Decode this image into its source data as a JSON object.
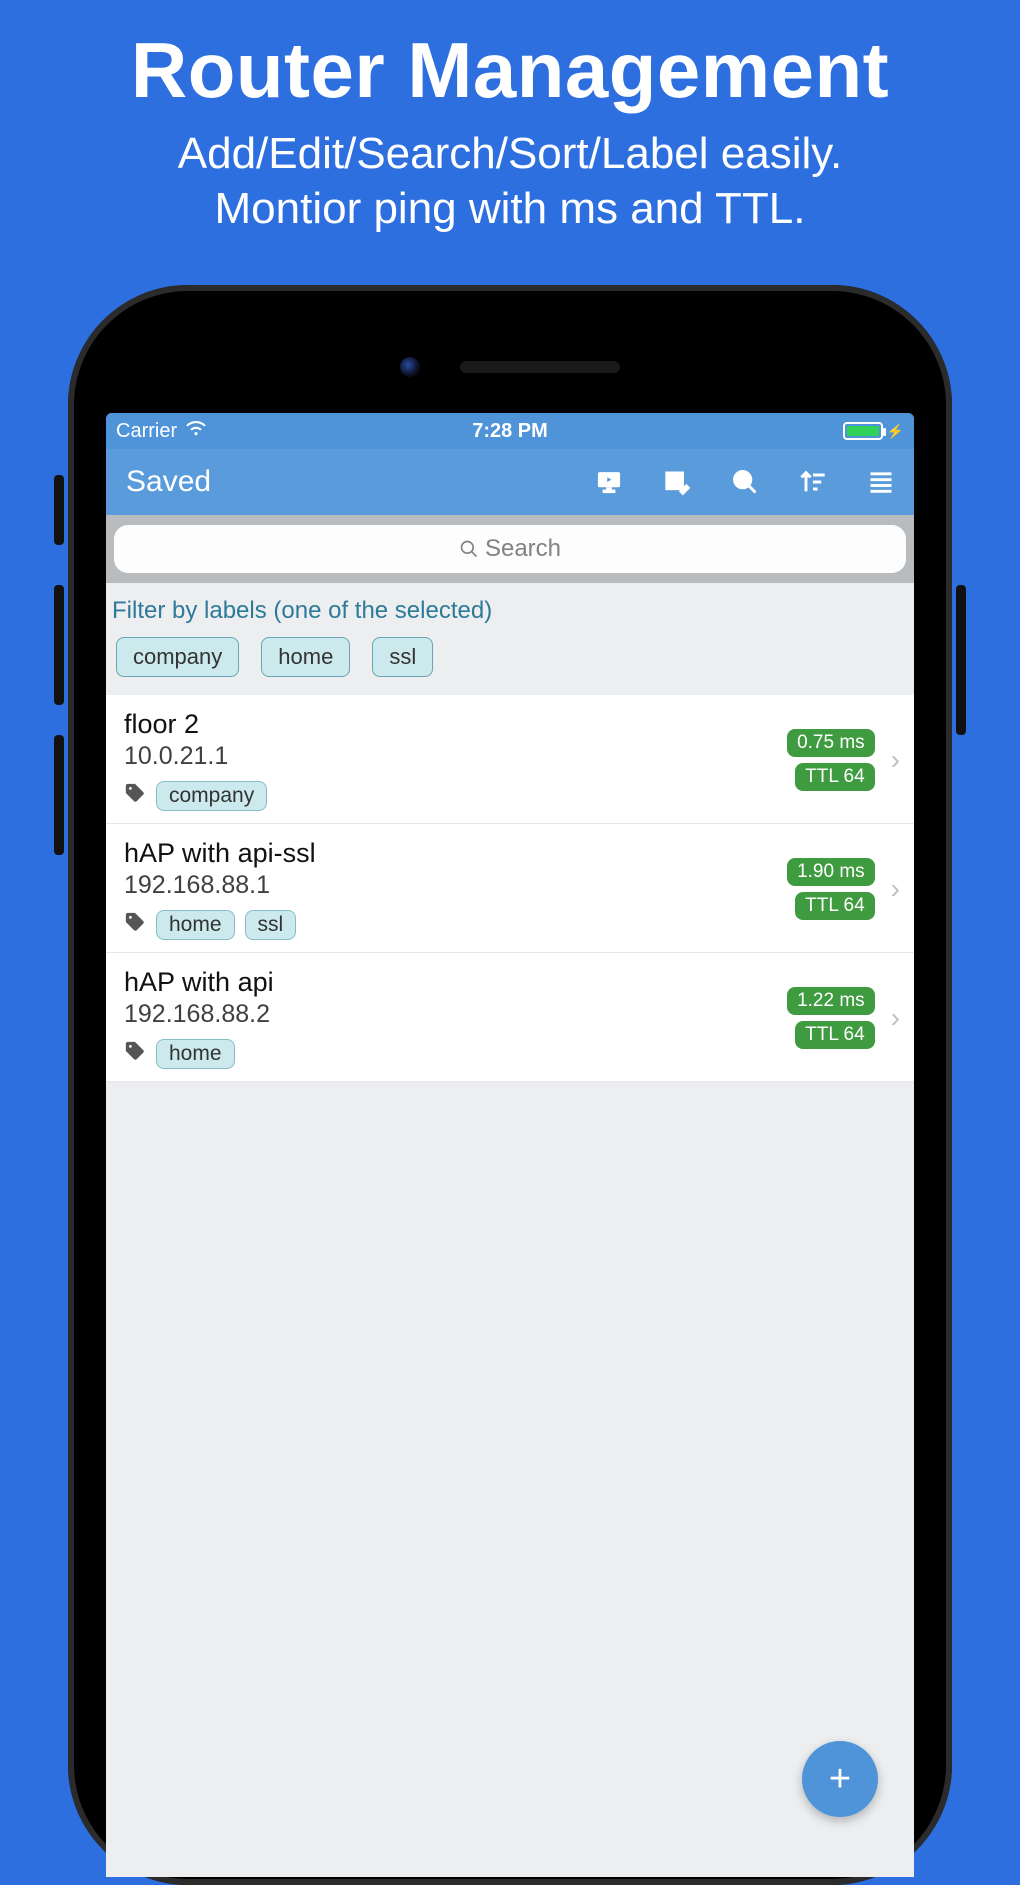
{
  "promo": {
    "title": "Router Management",
    "line1": "Add/Edit/Search/Sort/Label easily.",
    "line2": "Montior ping with ms and TTL."
  },
  "status": {
    "carrier": "Carrier",
    "time": "7:28 PM"
  },
  "nav": {
    "title": "Saved",
    "icons": {
      "monitor": "monitor-icon",
      "edit_table": "edit-table-icon",
      "search": "search-icon",
      "sort": "sort-icon",
      "menu": "menu-icon"
    }
  },
  "search": {
    "placeholder": "Search"
  },
  "filter": {
    "label": "Filter by labels (one of the selected)",
    "chips": [
      "company",
      "home",
      "ssl"
    ]
  },
  "routers": [
    {
      "name": "floor 2",
      "ip": "10.0.21.1",
      "tags": [
        "company"
      ],
      "ping_ms": "0.75 ms",
      "ttl": "TTL 64"
    },
    {
      "name": "hAP with api-ssl",
      "ip": "192.168.88.1",
      "tags": [
        "home",
        "ssl"
      ],
      "ping_ms": "1.90 ms",
      "ttl": "TTL 64"
    },
    {
      "name": "hAP with api",
      "ip": "192.168.88.2",
      "tags": [
        "home"
      ],
      "ping_ms": "1.22 ms",
      "ttl": "TTL 64"
    }
  ],
  "fab": {
    "label": "+"
  }
}
